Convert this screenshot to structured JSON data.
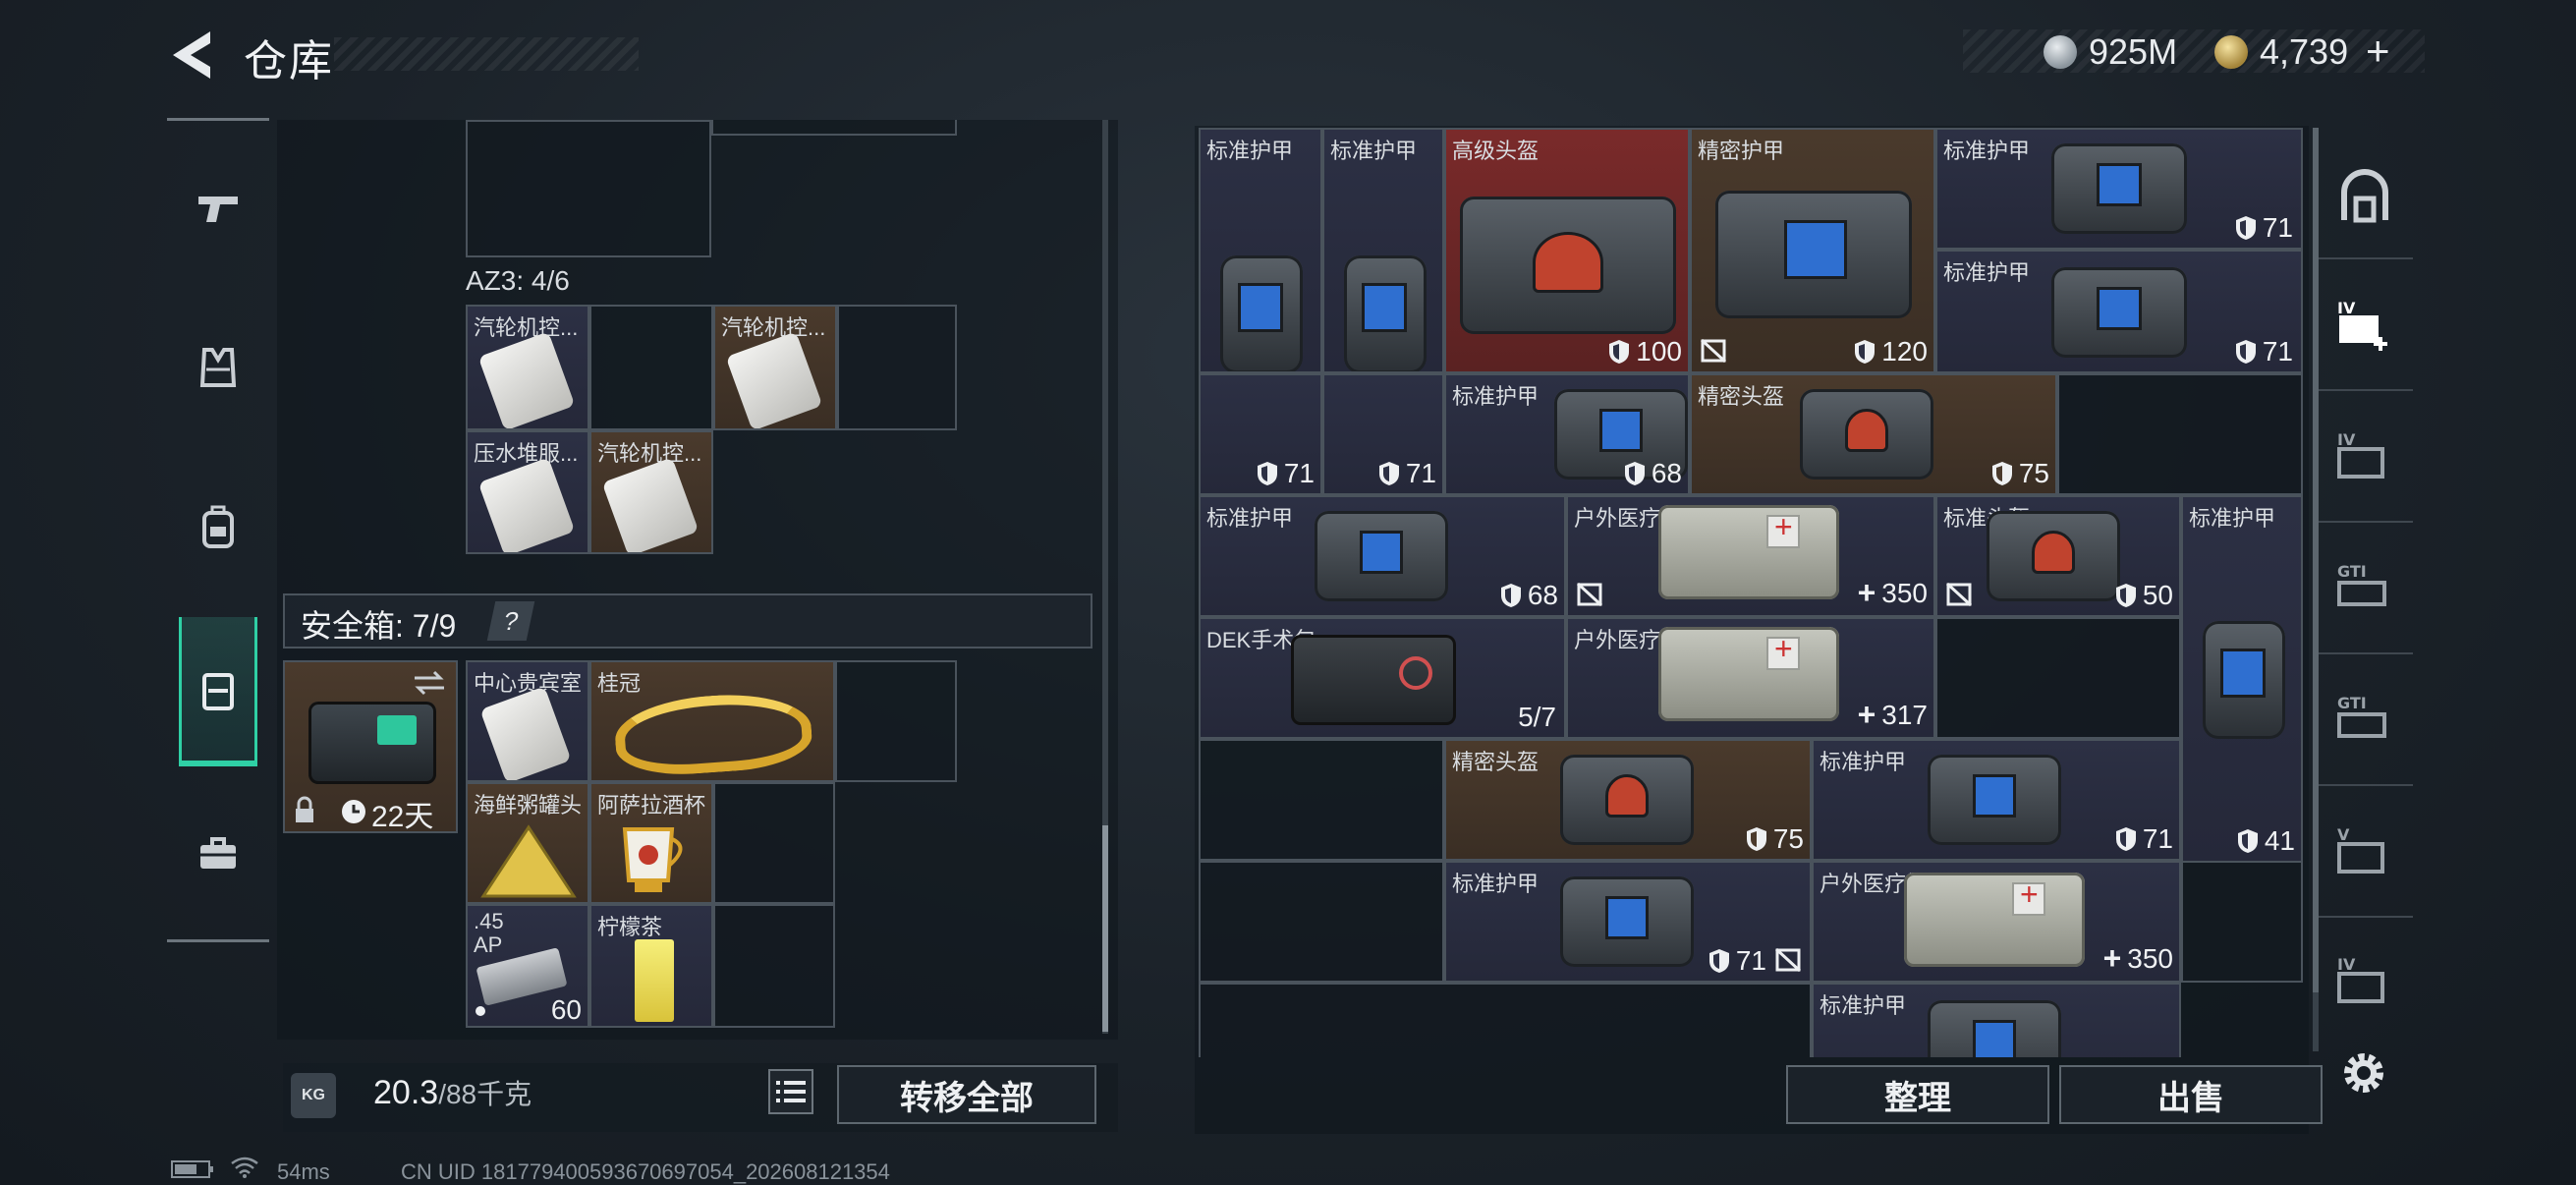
{
  "header": {
    "title": "仓库",
    "currency1": "925M",
    "currency2": "4,739",
    "add_label": "+"
  },
  "left": {
    "az3_label": "AZ3: 4/6",
    "az3_items": [
      "汽轮机控...",
      "汽轮机控...",
      "压水堆服...",
      "汽轮机控..."
    ],
    "safebox_label": "安全箱: 7/9",
    "safebox_help": "?",
    "safebox_timer": "22天",
    "safebox_items": [
      "中心贵宾室",
      "桂冠",
      "海鲜粥罐头",
      "阿萨拉酒杯",
      ".45\nAP",
      "柠檬茶"
    ],
    "ammo_count": "60",
    "weight_main": "20.3",
    "weight_sub": "/88千克",
    "weight_icon_text": "KG",
    "transfer_all": "转移全部"
  },
  "right": {
    "sort": "整理",
    "sell": "出售",
    "items": [
      {
        "label": "标准护甲",
        "stat": "71"
      },
      {
        "label": "标准护甲",
        "stat": "71"
      },
      {
        "label": "高级头盔",
        "stat": "100"
      },
      {
        "label": "精密护甲",
        "stat": "120"
      },
      {
        "label": "标准护甲",
        "stat": "71"
      },
      {
        "label": "标准护甲",
        "stat": "71"
      },
      {
        "label": "标准护甲",
        "stat": "68"
      },
      {
        "label": "精密头盔",
        "stat": "75"
      },
      {
        "label": "标准护甲",
        "stat": "68"
      },
      {
        "label": "户外医疗箱",
        "stat": "350"
      },
      {
        "label": "标准头盔",
        "stat": "50"
      },
      {
        "label": "标准护甲",
        "stat": "41"
      },
      {
        "label": "DEK手术包",
        "stat": "5/7"
      },
      {
        "label": "户外医疗箱",
        "stat": "317"
      },
      {
        "label": "精密头盔",
        "stat": "75"
      },
      {
        "label": "标准护甲",
        "stat": "71"
      },
      {
        "label": "标准护甲",
        "stat": "71"
      },
      {
        "label": "户外医疗箱",
        "stat": "350"
      },
      {
        "label": "标准护甲",
        "stat": ""
      }
    ]
  },
  "status": {
    "ping": "54ms",
    "uid": "CN UID 181779400593670697054_202608121354"
  },
  "colors": {
    "accent": "#2fd0a5",
    "brown_cell": "#4a3a2c",
    "navy_cell": "#2c3044",
    "red_cell": "#7a2a2a"
  }
}
